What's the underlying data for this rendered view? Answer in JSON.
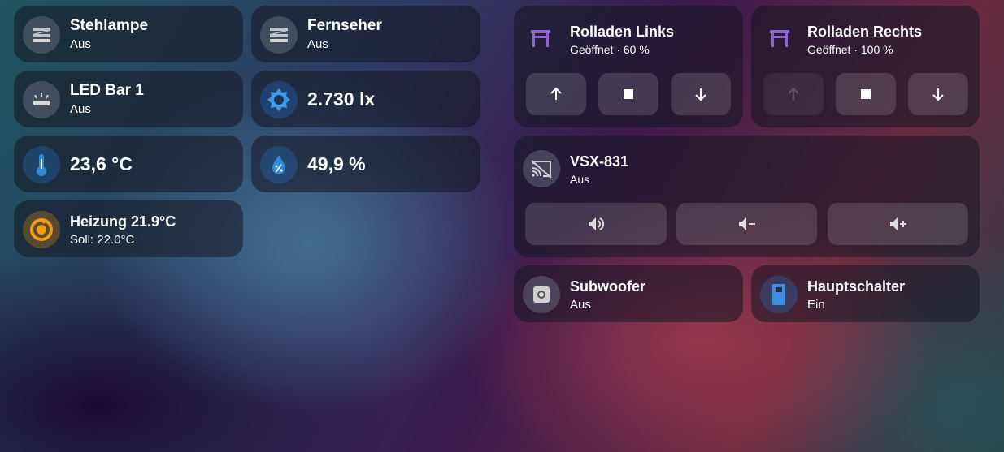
{
  "tiles": {
    "stehlampe": {
      "name": "Stehlampe",
      "state": "Aus",
      "icon": "led-strip-icon"
    },
    "fernseher": {
      "name": "Fernseher",
      "state": "Aus",
      "icon": "led-strip-icon"
    },
    "led_bar": {
      "name": "LED Bar 1",
      "state": "Aus",
      "icon": "ceiling-light-icon"
    },
    "illuminance": {
      "value": "2.730 lx",
      "icon": "brightness-icon"
    },
    "temperature": {
      "value": "23,6 °C",
      "icon": "thermometer-icon"
    },
    "humidity": {
      "value": "49,9 %",
      "icon": "water-percent-icon"
    },
    "heizung": {
      "name": "Heizung 21.9°C",
      "state": "Soll: 22.0°C",
      "icon": "thermostat-icon"
    }
  },
  "covers": [
    {
      "name": "Rolladen Links",
      "state": "Geöffnet · 60 %",
      "position_percent": 60,
      "icon": "window-shutter-open-icon"
    },
    {
      "name": "Rolladen Rechts",
      "state": "Geöffnet · 100 %",
      "position_percent": 100,
      "icon": "window-shutter-open-icon"
    }
  ],
  "media": {
    "name": "VSX-831",
    "state": "Aus",
    "icon": "cast-off-icon",
    "buttons": [
      "volume-high-icon",
      "volume-minus-icon",
      "volume-plus-icon"
    ]
  },
  "subwoofer": {
    "name": "Subwoofer",
    "state": "Aus",
    "icon": "speaker-icon"
  },
  "hauptschalter": {
    "name": "Hauptschalter",
    "state": "Ein",
    "icon": "power-socket-icon"
  },
  "colors": {
    "cover_icon": "#8f63c9",
    "illuminance_icon": "#3f9be8",
    "temperature_icon": "#2d8ad8",
    "humidity_icon": "#2d8ad8",
    "heating_icon": "#f39c12",
    "switch_on_icon": "#3f8de0"
  }
}
